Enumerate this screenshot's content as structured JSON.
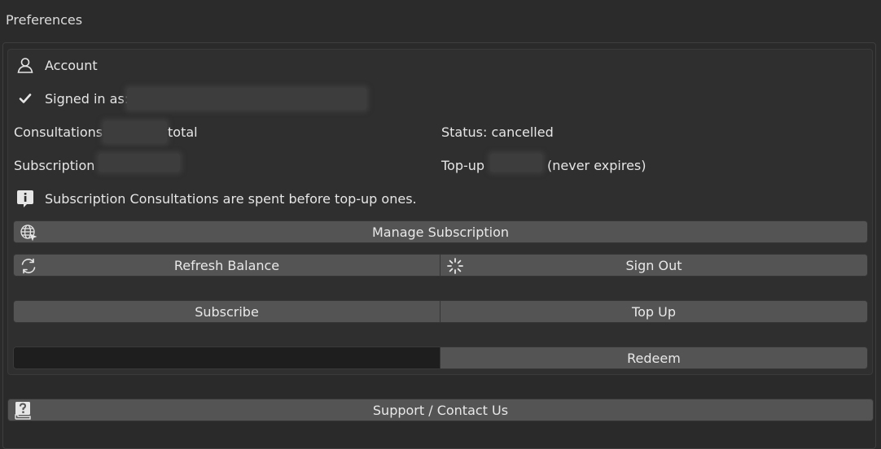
{
  "preferences_title": "Preferences",
  "account": {
    "header_label": "Account",
    "signed_in_prefix": "Signed in as:",
    "consultations_prefix": "Consultations:",
    "consultations_suffix": "total",
    "subscription_prefix": "Subscription",
    "status_text": "Status: cancelled",
    "topup_prefix": "Top-up",
    "topup_suffix": "(never expires)",
    "info_note": "Subscription Consultations are spent before top-up ones."
  },
  "buttons": {
    "manage_subscription": "Manage Subscription",
    "refresh_balance": "Refresh Balance",
    "sign_out": "Sign Out",
    "subscribe": "Subscribe",
    "top_up": "Top Up",
    "redeem": "Redeem",
    "support": "Support / Contact Us"
  },
  "icons": {
    "account": "user-icon",
    "signed_in": "checkmark-icon",
    "info": "info-icon",
    "manage": "globe-cursor-icon",
    "refresh": "refresh-icon",
    "sign_out": "loading-spinner-icon",
    "support": "help-book-icon"
  },
  "redeem_code_value": ""
}
